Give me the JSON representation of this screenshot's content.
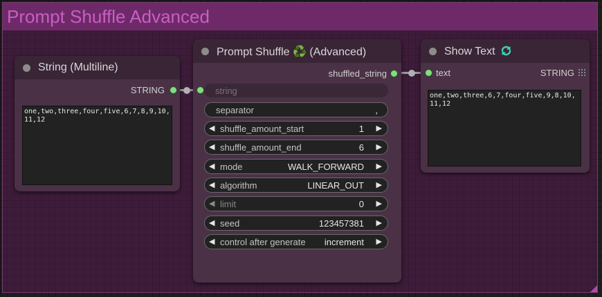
{
  "group": {
    "title": "Prompt Shuffle Advanced"
  },
  "node_string_multiline": {
    "title": "String (Multiline)",
    "output_label": "STRING",
    "text_value": "one,two,three,four,five,6,7,8,9,10,11,12"
  },
  "node_prompt_shuffle": {
    "title": "Prompt Shuffle ♻️ (Advanced)",
    "output_label": "shuffled_string",
    "input_label": "string",
    "widgets": [
      {
        "name": "separator",
        "value": ","
      },
      {
        "name": "shuffle_amount_start",
        "value": "1"
      },
      {
        "name": "shuffle_amount_end",
        "value": "6"
      },
      {
        "name": "mode",
        "value": "WALK_FORWARD"
      },
      {
        "name": "algorithm",
        "value": "LINEAR_OUT"
      },
      {
        "name": "limit",
        "value": "0"
      },
      {
        "name": "seed",
        "value": "123457381"
      },
      {
        "name": "control after generate",
        "value": "increment"
      }
    ]
  },
  "node_show_text": {
    "title": "Show Text",
    "icon": "recycle-refresh-icon",
    "input_label": "text",
    "output_label": "STRING",
    "text_value": "one,two,three,6,7,four,five,9,8,10,11,12"
  },
  "colors": {
    "group_fill": "#6e2a68",
    "group_title": "#c85ec4",
    "node_body": "#4a3146",
    "node_header": "#3a2537",
    "slot_connected": "#7ee07a",
    "widget_bg": "#222222"
  }
}
